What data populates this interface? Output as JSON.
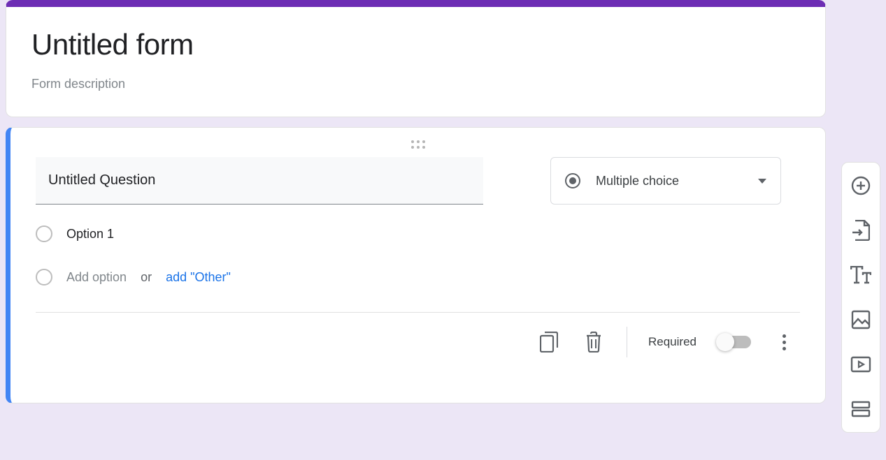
{
  "header": {
    "title": "Untitled form",
    "description_placeholder": "Form description"
  },
  "question": {
    "title": "Untitled Question",
    "type_label": "Multiple choice",
    "options": [
      {
        "label": "Option 1"
      }
    ],
    "add_option_text": "Add option",
    "or_text": "or",
    "add_other_text": "add \"Other\""
  },
  "footer": {
    "required_label": "Required",
    "required_value": false
  }
}
